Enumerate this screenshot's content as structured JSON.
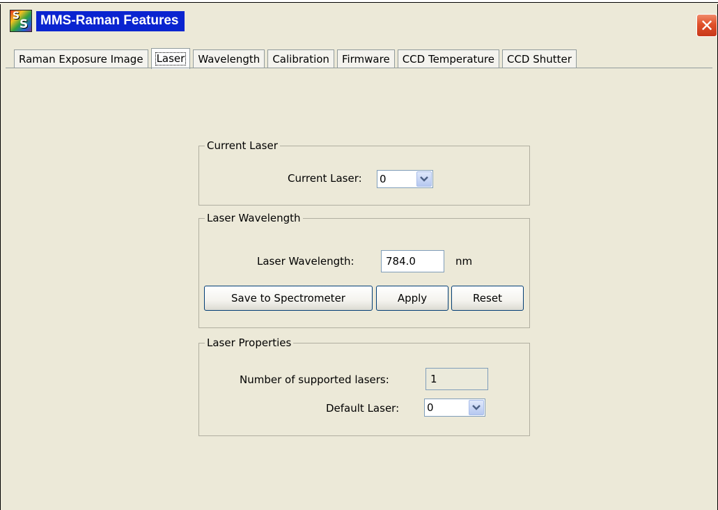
{
  "window": {
    "title": "MMS-Raman Features",
    "app_icon_letters": [
      "S",
      "S"
    ],
    "close_glyph": "✕"
  },
  "tabs": [
    {
      "label": "Raman Exposure Image",
      "active": false
    },
    {
      "label": "Laser",
      "active": true
    },
    {
      "label": "Wavelength",
      "active": false
    },
    {
      "label": "Calibration",
      "active": false
    },
    {
      "label": "Firmware",
      "active": false
    },
    {
      "label": "CCD Temperature",
      "active": false
    },
    {
      "label": "CCD Shutter",
      "active": false
    }
  ],
  "current_laser": {
    "legend": "Current Laser",
    "label": "Current Laser:",
    "value": "0"
  },
  "laser_wavelength": {
    "legend": "Laser Wavelength",
    "label": "Laser Wavelength:",
    "value": "784.0",
    "unit": "nm",
    "save_label": "Save to Spectrometer",
    "apply_label": "Apply",
    "reset_label": "Reset"
  },
  "laser_properties": {
    "legend": "Laser Properties",
    "count_label": "Number of supported lasers:",
    "count_value": "1",
    "default_label": "Default Laser:",
    "default_value": "0"
  },
  "colors": {
    "titlebar_highlight": "#0a24d0",
    "dialog_background": "#ece9d8",
    "close_button": "#e0502a"
  }
}
